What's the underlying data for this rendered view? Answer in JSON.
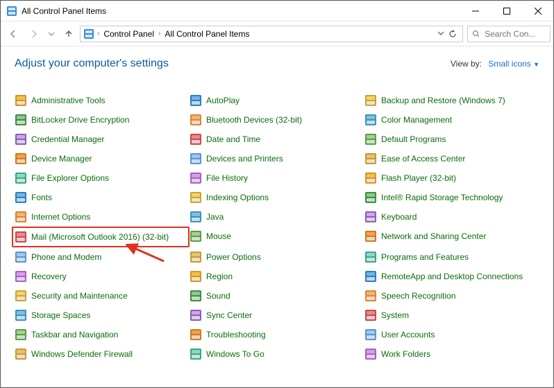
{
  "window": {
    "title": "All Control Panel Items"
  },
  "breadcrumb": {
    "root": "Control Panel",
    "current": "All Control Panel Items"
  },
  "search": {
    "placeholder": "Search Con..."
  },
  "header": {
    "heading": "Adjust your computer's settings",
    "viewby_label": "View by:",
    "viewby_value": "Small icons"
  },
  "columns": [
    [
      {
        "id": "administrative-tools",
        "label": "Administrative Tools"
      },
      {
        "id": "bitlocker",
        "label": "BitLocker Drive Encryption"
      },
      {
        "id": "credential-manager",
        "label": "Credential Manager"
      },
      {
        "id": "device-manager",
        "label": "Device Manager"
      },
      {
        "id": "file-explorer-options",
        "label": "File Explorer Options"
      },
      {
        "id": "fonts",
        "label": "Fonts"
      },
      {
        "id": "internet-options",
        "label": "Internet Options"
      },
      {
        "id": "mail",
        "label": "Mail (Microsoft Outlook 2016) (32-bit)",
        "highlight": true
      },
      {
        "id": "phone-modem",
        "label": "Phone and Modem"
      },
      {
        "id": "recovery",
        "label": "Recovery"
      },
      {
        "id": "security-maintenance",
        "label": "Security and Maintenance"
      },
      {
        "id": "storage-spaces",
        "label": "Storage Spaces"
      },
      {
        "id": "taskbar-navigation",
        "label": "Taskbar and Navigation"
      },
      {
        "id": "windows-defender-firewall",
        "label": "Windows Defender Firewall"
      }
    ],
    [
      {
        "id": "autoplay",
        "label": "AutoPlay"
      },
      {
        "id": "bluetooth",
        "label": "Bluetooth Devices (32-bit)"
      },
      {
        "id": "date-time",
        "label": "Date and Time"
      },
      {
        "id": "devices-printers",
        "label": "Devices and Printers"
      },
      {
        "id": "file-history",
        "label": "File History"
      },
      {
        "id": "indexing-options",
        "label": "Indexing Options"
      },
      {
        "id": "java",
        "label": "Java"
      },
      {
        "id": "mouse",
        "label": "Mouse"
      },
      {
        "id": "power-options",
        "label": "Power Options"
      },
      {
        "id": "region",
        "label": "Region"
      },
      {
        "id": "sound",
        "label": "Sound"
      },
      {
        "id": "sync-center",
        "label": "Sync Center"
      },
      {
        "id": "troubleshooting",
        "label": "Troubleshooting"
      },
      {
        "id": "windows-to-go",
        "label": "Windows To Go"
      }
    ],
    [
      {
        "id": "backup-restore",
        "label": "Backup and Restore (Windows 7)"
      },
      {
        "id": "color-management",
        "label": "Color Management"
      },
      {
        "id": "default-programs",
        "label": "Default Programs"
      },
      {
        "id": "ease-of-access",
        "label": "Ease of Access Center"
      },
      {
        "id": "flash-player",
        "label": "Flash Player (32-bit)"
      },
      {
        "id": "intel-rst",
        "label": "Intel® Rapid Storage Technology"
      },
      {
        "id": "keyboard",
        "label": "Keyboard"
      },
      {
        "id": "network-sharing",
        "label": "Network and Sharing Center"
      },
      {
        "id": "programs-features",
        "label": "Programs and Features"
      },
      {
        "id": "remoteapp",
        "label": "RemoteApp and Desktop Connections"
      },
      {
        "id": "speech-recognition",
        "label": "Speech Recognition"
      },
      {
        "id": "system",
        "label": "System"
      },
      {
        "id": "user-accounts",
        "label": "User Accounts"
      },
      {
        "id": "work-folders",
        "label": "Work Folders"
      }
    ]
  ]
}
